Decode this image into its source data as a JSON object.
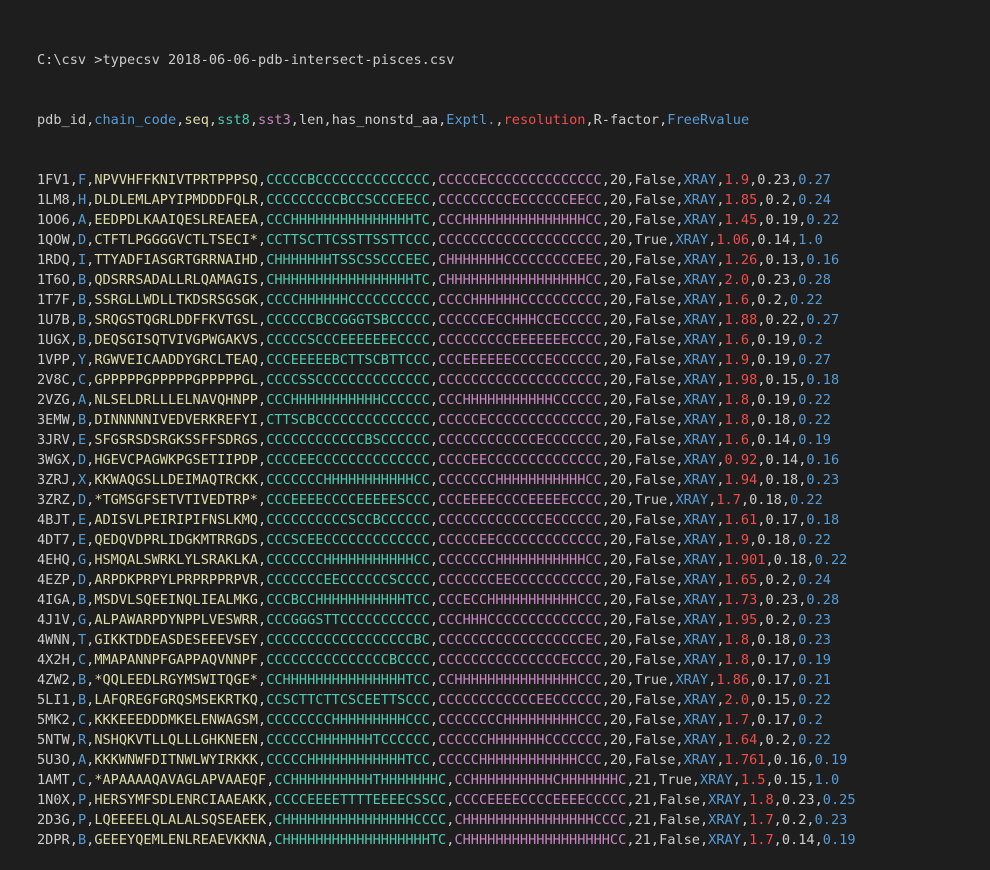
{
  "prompt": "C:\\csv >typecsv 2018-06-06-pdb-intersect-pisces.csv",
  "column_colors": [
    "#cccccc",
    "#569cd6",
    "#dcdcaa",
    "#4ec9b0",
    "#c586c0",
    "#cccccc",
    "#cccccc",
    "#569cd6",
    "#f14c4c",
    "#cccccc",
    "#569cd6"
  ],
  "comma_color": "#cccccc",
  "header": [
    "pdb_id",
    "chain_code",
    "seq",
    "sst8",
    "sst3",
    "len",
    "has_nonstd_aa",
    "Exptl.",
    "resolution",
    "R-factor",
    "FreeRvalue"
  ],
  "rows": [
    [
      "1FV1",
      "F",
      "NPVVHFFKNIVTPRTPPPSQ",
      "CCCCCBCCCCCCCCCCCCCC",
      "CCCCCECCCCCCCCCCCCCC",
      "20",
      "False",
      "XRAY",
      "1.9",
      "0.23",
      "0.27"
    ],
    [
      "1LM8",
      "H",
      "DLDLEMLAPYIPMDDDFQLR",
      "CCCCCCCCCBCCSCCCEECC",
      "CCCCCCCCCECCCCCCEECC",
      "20",
      "False",
      "XRAY",
      "1.85",
      "0.2",
      "0.24"
    ],
    [
      "1OO6",
      "A",
      "EEDPDLKAAIQESLREAEEA",
      "CCCHHHHHHHHHHHHHHHTC",
      "CCCHHHHHHHHHHHHHHHCC",
      "20",
      "False",
      "XRAY",
      "1.45",
      "0.19",
      "0.22"
    ],
    [
      "1QOW",
      "D",
      "CTFTLPGGGGVCTLTSECI*",
      "CCTTSCTTCSSTTSSTTCCC",
      "CCCCCCCCCCCCCCCCCCCC",
      "20",
      "True",
      "XRAY",
      "1.06",
      "0.14",
      "1.0"
    ],
    [
      "1RDQ",
      "I",
      "TTYADFIASGRTGRRNAIHD",
      "CHHHHHHHTSSCSSCCCEEC",
      "CHHHHHHHCCCCCCCCCEEC",
      "20",
      "False",
      "XRAY",
      "1.26",
      "0.13",
      "0.16"
    ],
    [
      "1T6O",
      "B",
      "QDSRRSADALLRLQAMAGIS",
      "CHHHHHHHHHHHHHHHHHTC",
      "CHHHHHHHHHHHHHHHHHCC",
      "20",
      "False",
      "XRAY",
      "2.0",
      "0.23",
      "0.28"
    ],
    [
      "1T7F",
      "B",
      "SSRGLLWDLLTKDSRSGSGK",
      "CCCCHHHHHHCCCCCCCCCC",
      "CCCCHHHHHHCCCCCCCCCC",
      "20",
      "False",
      "XRAY",
      "1.6",
      "0.2",
      "0.22"
    ],
    [
      "1U7B",
      "B",
      "SRQGSTQGRLDDFFKVTGSL",
      "CCCCCCBCCGGGTSBCCCCC",
      "CCCCCCECCHHHCCECCCCC",
      "20",
      "False",
      "XRAY",
      "1.88",
      "0.22",
      "0.27"
    ],
    [
      "1UGX",
      "B",
      "DEQSGISQTVIVGPWGAKVS",
      "CCCCCSCCCEEEEEEECCCC",
      "CCCCCCCCCEEEEEEECCCC",
      "20",
      "False",
      "XRAY",
      "1.6",
      "0.19",
      "0.2"
    ],
    [
      "1VPP",
      "Y",
      "RGWVEICAADDYGRCLTEAQ",
      "CCCEEEEEBCTTSCBTTCCC",
      "CCCEEEEEECCCCECCCCCC",
      "20",
      "False",
      "XRAY",
      "1.9",
      "0.19",
      "0.27"
    ],
    [
      "2V8C",
      "C",
      "GPPPPPGPPPPPGPPPPPGL",
      "CCCCSSCCCCCCCCCCCCCC",
      "CCCCCCCCCCCCCCCCCCCC",
      "20",
      "False",
      "XRAY",
      "1.98",
      "0.15",
      "0.18"
    ],
    [
      "2VZG",
      "A",
      "NLSELDRLLLELNAVQHNPP",
      "CCCHHHHHHHHHHHCCCCCC",
      "CCCHHHHHHHHHHHCCCCCC",
      "20",
      "False",
      "XRAY",
      "1.8",
      "0.19",
      "0.22"
    ],
    [
      "3EMW",
      "B",
      "DINNNNNIVEDVERKREFYI",
      "CTTSCBCCCCCCCCCCCCCC",
      "CCCCCECCCCCCCCCCCCCC",
      "20",
      "False",
      "XRAY",
      "1.8",
      "0.18",
      "0.22"
    ],
    [
      "3JRV",
      "E",
      "SFGSRSDSRGKSSFFSDRGS",
      "CCCCCCCCCCCCBSCCCCCC",
      "CCCCCCCCCCCCECCCCCCC",
      "20",
      "False",
      "XRAY",
      "1.6",
      "0.14",
      "0.19"
    ],
    [
      "3WGX",
      "D",
      "HGEVCPAGWKPGSETIIPDP",
      "CCCCEECCCCCCCCCCCCCC",
      "CCCCEECCCCCCCCCCCCCC",
      "20",
      "False",
      "XRAY",
      "0.92",
      "0.14",
      "0.16"
    ],
    [
      "3ZRJ",
      "X",
      "KKWAQGSLLDEIMAQTRCKK",
      "CCCCCCCHHHHHHHHHHHCC",
      "CCCCCCCHHHHHHHHHHHCC",
      "20",
      "False",
      "XRAY",
      "1.94",
      "0.18",
      "0.23"
    ],
    [
      "3ZRZ",
      "D",
      "*TGMSGFSETVTIVEDTRP*",
      "CCCEEEECCCCEEEEESCCC",
      "CCCEEEECCCCEEEEECCCC",
      "20",
      "True",
      "XRAY",
      "1.7",
      "0.18",
      "0.22"
    ],
    [
      "4BJT",
      "E",
      "ADISVLPEIRIPIFNSLKMQ",
      "CCCCCCCCCCSCCBCCCCCC",
      "CCCCCCCCCCCCCECCCCCC",
      "20",
      "False",
      "XRAY",
      "1.61",
      "0.17",
      "0.18"
    ],
    [
      "4DT7",
      "E",
      "QEDQVDPRLIDGKMTRRGDS",
      "CCCSCEECCCCCCCCCCCCC",
      "CCCCCEECCCCCCCCCCCCC",
      "20",
      "False",
      "XRAY",
      "1.9",
      "0.18",
      "0.22"
    ],
    [
      "4EHQ",
      "G",
      "HSMQALSWRKLYLSRAKLKA",
      "CCCCCCCHHHHHHHHHHHCC",
      "CCCCCCCHHHHHHHHHHHCC",
      "20",
      "False",
      "XRAY",
      "1.901",
      "0.18",
      "0.22"
    ],
    [
      "4EZP",
      "D",
      "ARPDKPRPYLPRPRPPRPVR",
      "CCCCCCCEECCCCCCSCCCC",
      "CCCCCCCEECCCCCCCCCCC",
      "20",
      "False",
      "XRAY",
      "1.65",
      "0.2",
      "0.24"
    ],
    [
      "4IGA",
      "B",
      "MSDVLSQEEINQLIEALMKG",
      "CCCBCCHHHHHHHHHHHTCC",
      "CCCECCHHHHHHHHHHHCCC",
      "20",
      "False",
      "XRAY",
      "1.73",
      "0.23",
      "0.28"
    ],
    [
      "4J1V",
      "G",
      "ALPAWARPDYNPPLVESWRR",
      "CCCGGGSTTCCCCCCCCCCC",
      "CCCHHHCCCCCCCCCCCCCC",
      "20",
      "False",
      "XRAY",
      "1.95",
      "0.2",
      "0.23"
    ],
    [
      "4WNN",
      "T",
      "GIKKTDDEASDESEEEVSEY",
      "CCCCCCCCCCCCCCCCCCBC",
      "CCCCCCCCCCCCCCCCCCEC",
      "20",
      "False",
      "XRAY",
      "1.8",
      "0.18",
      "0.23"
    ],
    [
      "4X2H",
      "C",
      "MMAPANNPFGAPPAQVNNPF",
      "CCCCCCCCCCCCCCCBCCCC",
      "CCCCCCCCCCCCCCCECCCC",
      "20",
      "False",
      "XRAY",
      "1.8",
      "0.17",
      "0.19"
    ],
    [
      "4ZW2",
      "B",
      "*QQLEEDLRGYMSWITQGE*",
      "CCHHHHHHHHHHHHHHHTCC",
      "CCHHHHHHHHHHHHHHHCCC",
      "20",
      "True",
      "XRAY",
      "1.86",
      "0.17",
      "0.21"
    ],
    [
      "5LI1",
      "B",
      "LAFQREGFGRQSMSEKRTKQ",
      "CCSCTTCTTCSCEETTSCCC",
      "CCCCCCCCCCCCEECCCCCC",
      "20",
      "False",
      "XRAY",
      "2.0",
      "0.15",
      "0.22"
    ],
    [
      "5MK2",
      "C",
      "KKKEEEDDDMKELENWAGSM",
      "CCCCCCCCHHHHHHHHHCCC",
      "CCCCCCCCHHHHHHHHHCCC",
      "20",
      "False",
      "XRAY",
      "1.7",
      "0.17",
      "0.2"
    ],
    [
      "5NTW",
      "R",
      "NSHQKVTLLQLLLGHKNEEN",
      "CCCCCCHHHHHHHTCCCCCC",
      "CCCCCCHHHHHHHCCCCCCC",
      "20",
      "False",
      "XRAY",
      "1.64",
      "0.2",
      "0.22"
    ],
    [
      "5U3O",
      "A",
      "KKKWNWFDITNWLWYIRKKK",
      "CCCCCHHHHHHHHHHHHTCC",
      "CCCCCHHHHHHHHHHHHCCC",
      "20",
      "False",
      "XRAY",
      "1.761",
      "0.16",
      "0.19"
    ],
    [
      "1AMT",
      "C",
      "*APAAAAQAVAGLAPVAAEQF",
      "CCHHHHHHHHHHTHHHHHHHC",
      "CCHHHHHHHHHHCHHHHHHHC",
      "21",
      "True",
      "XRAY",
      "1.5",
      "0.15",
      "1.0"
    ],
    [
      "1N0X",
      "P",
      "HERSYMFSDLENRCIAAEAKK",
      "CCCCEEEETTTTEEEECSSCC",
      "CCCCEEEECCCCEEEECCCCC",
      "21",
      "False",
      "XRAY",
      "1.8",
      "0.23",
      "0.25"
    ],
    [
      "2D3G",
      "P",
      "LQEEEELQLALALSQSEAEEK",
      "CHHHHHHHHHHHHHHHHCCCC",
      "CHHHHHHHHHHHHHHHHCCCC",
      "21",
      "False",
      "XRAY",
      "1.7",
      "0.2",
      "0.23"
    ],
    [
      "2DPR",
      "B",
      "GEEEYQEMLENLREAEVKKNA",
      "CHHHHHHHHHHHHHHHHHHTC",
      "CHHHHHHHHHHHHHHHHHHCC",
      "21",
      "False",
      "XRAY",
      "1.7",
      "0.14",
      "0.19"
    ]
  ]
}
